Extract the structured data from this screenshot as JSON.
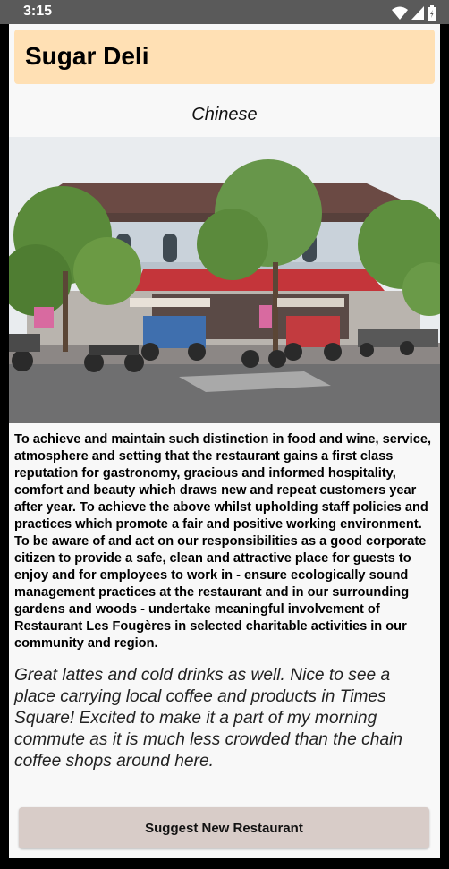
{
  "status_bar": {
    "time": "3:15",
    "icons": [
      "wifi-icon",
      "signal-icon",
      "battery-icon"
    ]
  },
  "restaurant": {
    "name": "Sugar Deli",
    "cuisine": "Chinese",
    "description": "To achieve and maintain such distinction in food and wine, service, atmosphere and setting that the restaurant gains a first class reputation for gastronomy, gracious and informed hospitality, comfort and beauty which draws new and repeat customers year after year. To achieve the above whilst upholding staff policies and practices which promote a fair and positive working environment. To be aware of and act on our responsibilities as a good corporate citizen to  provide a safe, clean and attractive place for guests to enjoy and for employees to work in - ensure ecologically sound management practices at the restaurant and in our surrounding gardens and woods - undertake meaningful involvement of Restaurant Les Fougères in selected charitable activities in our community and region.",
    "review": "Great lattes and cold drinks as well. Nice to see a place carrying local coffee and products in Times Square! Excited to make it a part of my morning commute as it is much less crowded than the chain coffee shops around here."
  },
  "actions": {
    "suggest_label": "Suggest New Restaurant"
  },
  "colors": {
    "title_card": "#ffe0b4",
    "button": "#d8ccc8",
    "status_bar": "#5a5a5a"
  }
}
